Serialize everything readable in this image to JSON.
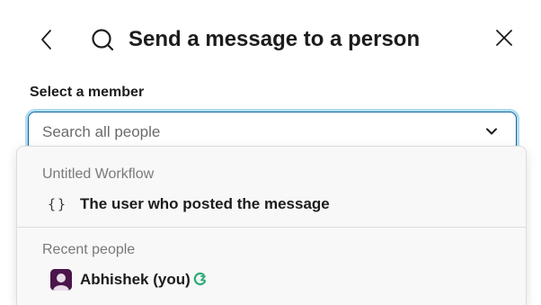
{
  "header": {
    "title": "Send a message to a person",
    "back_icon": "chevron-left-icon",
    "title_icon": "search-icon",
    "close_icon": "close-icon"
  },
  "field": {
    "label": "Select a member",
    "placeholder": "Search all people",
    "value": ""
  },
  "dropdown": {
    "groups": [
      {
        "label": "Untitled Workflow",
        "options": [
          {
            "icon": "variable-braces-icon",
            "icon_text": "{}",
            "label": "The user who posted the message"
          }
        ]
      },
      {
        "label": "Recent people",
        "options": [
          {
            "icon": "avatar",
            "label": "Abhishek (you)",
            "status_icon": "status-icon"
          }
        ]
      }
    ]
  },
  "colors": {
    "focus_border": "#1264a3",
    "focus_ring": "#1d9bd1",
    "avatar_bg": "#4a154b",
    "status_green": "#2bac76"
  }
}
